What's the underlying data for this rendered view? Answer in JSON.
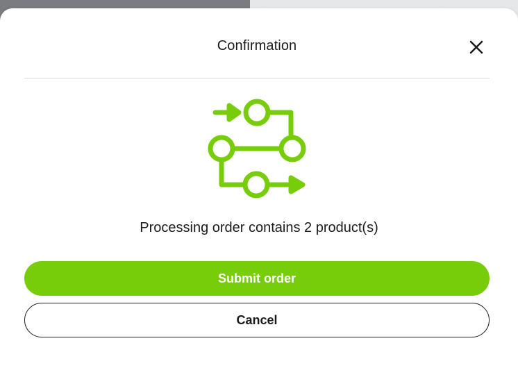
{
  "modal": {
    "title": "Confirmation",
    "message": "Processing order contains 2 product(s)"
  },
  "actions": {
    "submit_label": "Submit order",
    "cancel_label": "Cancel"
  },
  "icons": {
    "close": "close-icon",
    "illustration": "order-process-flow-icon"
  },
  "colors": {
    "accent": "#78cd0a",
    "text": "#1b1b1b",
    "divider": "#d8d9db",
    "backdrop": "#7d7e82"
  }
}
